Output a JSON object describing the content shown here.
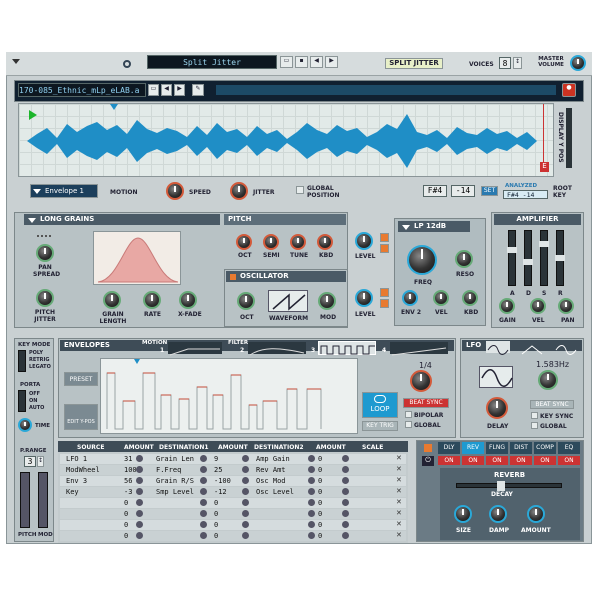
{
  "header": {
    "patch_name": "Split Jitter",
    "patch_label": "SPLIT JITTER",
    "voices_label": "VOICES",
    "voices_value": "8",
    "master_volume_label": "MASTER VOLUME"
  },
  "sample": {
    "filename": "170-085_Ethnic_mLp_eLAB.a",
    "envelope_select": "Envelope 1",
    "motion_label": "MOTION",
    "speed_label": "SPEED",
    "jitter_label": "JITTER",
    "global_position_label": "GLOBAL POSITION",
    "display_y_pos_label": "DISPLAY Y POS",
    "root_note": "F#4",
    "tune": "-14",
    "set_label": "SET",
    "analyzed_label": "ANALYZED",
    "analyzed_value": "F#4 -14",
    "root_key_label": "ROOT KEY",
    "marker_e": "E"
  },
  "grain": {
    "mode": "LONG GRAINS",
    "pan_spread_label": "PAN SPREAD",
    "pitch_jitter_label": "PITCH JITTER",
    "grain_length_label": "GRAIN LENGTH",
    "rate_label": "RATE",
    "xfade_label": "X-FADE"
  },
  "pitch": {
    "title": "PITCH",
    "oct": "OCT",
    "semi": "SEMI",
    "tune": "TUNE",
    "kbd": "KBD",
    "level": "LEVEL"
  },
  "oscillator": {
    "title": "OSCILLATOR",
    "oct": "OCT",
    "waveform": "WAVEFORM",
    "mod": "MOD",
    "level": "LEVEL"
  },
  "filter": {
    "type": "LP 12dB",
    "freq": "FREQ",
    "reso": "RESO",
    "env2": "ENV 2",
    "vel": "VEL",
    "kbd": "KBD"
  },
  "amplifier": {
    "title": "AMPLIFIER",
    "sliders": [
      "A",
      "D",
      "S",
      "R"
    ],
    "gain": "GAIN",
    "vel": "VEL",
    "pan": "PAN"
  },
  "keymode": {
    "key_mode_label": "KEY MODE",
    "options": [
      "POLY",
      "RETRIG",
      "LEGATO"
    ],
    "porta_label": "PORTA",
    "porta_options": [
      "OFF",
      "ON",
      "AUTO"
    ],
    "time_label": "TIME",
    "prange_label": "P.RANGE",
    "prange_value": "3",
    "pitch_label": "PITCH",
    "mod_label": "MOD"
  },
  "envelopes": {
    "title": "ENVELOPES",
    "tabs": [
      {
        "name": "MOTION",
        "num": "1"
      },
      {
        "name": "FILTER",
        "num": "2"
      },
      {
        "name": "",
        "num": "3"
      },
      {
        "name": "",
        "num": "4"
      }
    ],
    "preset": "PRESET",
    "edit_ypos": "EDIT Y-POS",
    "loop": "LOOP",
    "key_trig": "KEY TRIG",
    "rate": "1/4",
    "beat_sync": "BEAT SYNC",
    "bipolar": "BIPOLAR",
    "global": "GLOBAL"
  },
  "lfo": {
    "title": "LFO",
    "rate": "1.583Hz",
    "beat_sync": "BEAT SYNC",
    "key_sync": "KEY SYNC",
    "global": "GLOBAL",
    "delay": "DELAY",
    "rate_label": "RATE"
  },
  "mod_matrix": {
    "headers": [
      "SOURCE",
      "AMOUNT",
      "DESTINATION1",
      "AMOUNT",
      "DESTINATION2",
      "AMOUNT",
      "SCALE"
    ],
    "rows": [
      {
        "source": "LFO 1",
        "amt1": "31",
        "dest1": "Grain Len",
        "amt2": "9",
        "dest2": "Amp Gain",
        "amt3": "0"
      },
      {
        "source": "ModWheel",
        "amt1": "100",
        "dest1": "F.Freq",
        "amt2": "25",
        "dest2": "Rev Amt",
        "amt3": "0"
      },
      {
        "source": "Env 3",
        "amt1": "56",
        "dest1": "Grain R/S",
        "amt2": "-100",
        "dest2": "Osc Mod",
        "amt3": "0"
      },
      {
        "source": "Key",
        "amt1": "-3",
        "dest1": "Smp Level",
        "amt2": "-12",
        "dest2": "Osc Level",
        "amt3": "0"
      },
      {
        "source": "",
        "amt1": "0",
        "dest1": "",
        "amt2": "0",
        "dest2": "",
        "amt3": "0"
      },
      {
        "source": "",
        "amt1": "0",
        "dest1": "",
        "amt2": "0",
        "dest2": "",
        "amt3": "0"
      },
      {
        "source": "",
        "amt1": "0",
        "dest1": "",
        "amt2": "0",
        "dest2": "",
        "amt3": "0"
      },
      {
        "source": "",
        "amt1": "0",
        "dest1": "",
        "amt2": "0",
        "dest2": "",
        "amt3": "0"
      }
    ]
  },
  "fx": {
    "tabs": [
      "DLY",
      "REV",
      "FLNG",
      "DIST",
      "COMP",
      "EQ"
    ],
    "on_labels": [
      "ON",
      "ON",
      "ON",
      "ON",
      "ON",
      "ON"
    ],
    "active_title": "REVERB",
    "decay": "DECAY",
    "size": "SIZE",
    "damp": "DAMP",
    "amount": "AMOUNT"
  }
}
